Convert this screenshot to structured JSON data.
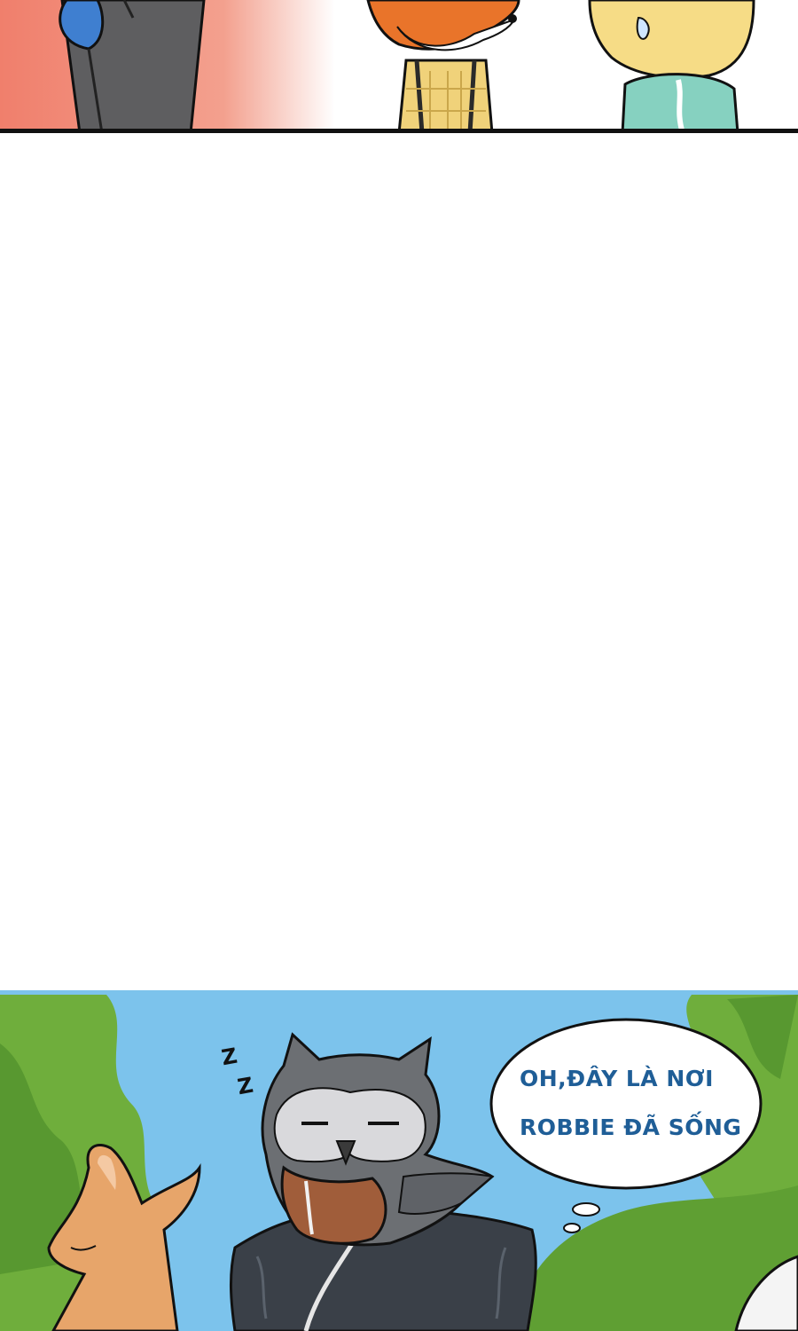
{
  "speech_bubble": {
    "line1": "OH,ĐÂY LÀ NƠI",
    "line2": "ROBBIE ĐÃ SỐNG"
  },
  "sleep_marks": {
    "z1": "Z",
    "z2": "Z"
  },
  "colors": {
    "top_panel_bg": "#f08a78",
    "sky": "#7cc3ec",
    "foliage": "#6fae3c",
    "speech_text": "#1f5e97",
    "border": "#111111"
  }
}
